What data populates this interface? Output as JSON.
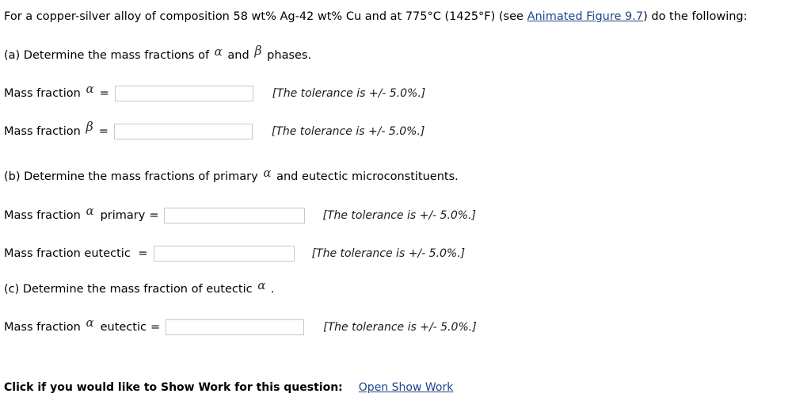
{
  "prompt": {
    "part1": "For a copper-silver alloy of composition 58 wt% Ag-42 wt% Cu and at 775",
    "degree_c": "°C (1425",
    "degree_f": "°F) (see ",
    "link_text": "Animated Figure 9.7",
    "part2": ") do the following:",
    "link_color": "#21468b"
  },
  "glyphs": {
    "alpha": "α",
    "beta": "β"
  },
  "sections": {
    "a": {
      "prefix": "(a) Determine the mass fractions of ",
      "middle": " and ",
      "suffix": " phases."
    },
    "b": {
      "prefix": "(b) Determine the mass fractions of primary ",
      "suffix": " and eutectic microconstituents."
    },
    "c": {
      "prefix": "(c) Determine the mass fraction of eutectic ",
      "suffix": " ."
    }
  },
  "answers": {
    "alpha": {
      "label": "Mass fraction ",
      "suffix": "",
      "equals": "=",
      "value": "",
      "placeholder": "",
      "tolerance": "[The tolerance is +/- 5.0%.]"
    },
    "beta": {
      "label": "Mass fraction ",
      "suffix": "",
      "equals": "=",
      "value": "",
      "placeholder": "",
      "tolerance": "[The tolerance is +/- 5.0%.]"
    },
    "primary_alpha": {
      "label": "Mass fraction ",
      "suffix": "primary",
      "equals": "=",
      "value": "",
      "placeholder": "",
      "tolerance": "[The tolerance is +/- 5.0%.]"
    },
    "eutectic": {
      "label": "Mass fraction eutectic ",
      "suffix": "",
      "equals": "=",
      "value": "",
      "placeholder": "",
      "tolerance": "[The tolerance is +/- 5.0%.]"
    },
    "eutectic_alpha": {
      "label": "Mass fraction ",
      "suffix": "eutectic",
      "equals": "=",
      "value": "",
      "placeholder": "",
      "tolerance": "[The tolerance is +/- 5.0%.]"
    }
  },
  "footer": {
    "label": "Click if you would like to Show Work for this question:",
    "link_text": "Open Show Work",
    "link_color": "#21468b"
  }
}
